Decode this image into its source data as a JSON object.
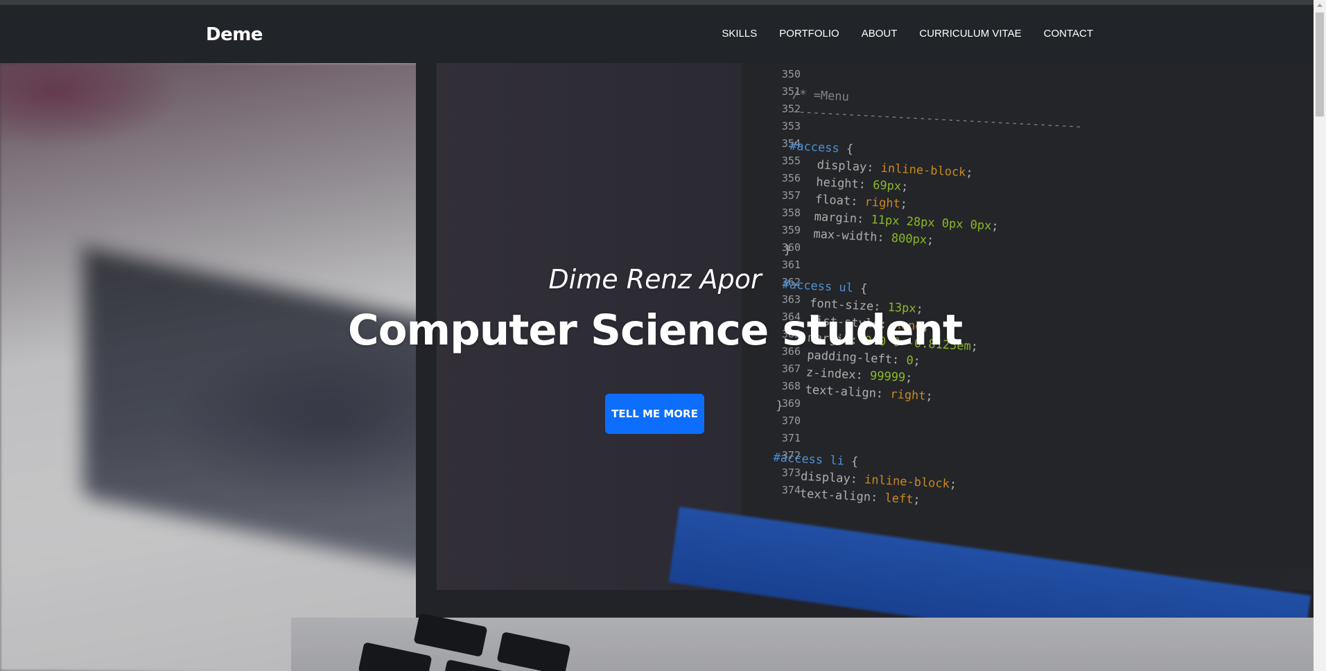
{
  "navbar": {
    "brand": "Deme",
    "links": [
      {
        "label": "SKILLS"
      },
      {
        "label": "PORTFOLIO"
      },
      {
        "label": "ABOUT"
      },
      {
        "label": "CURRICULUM VITAE"
      },
      {
        "label": "CONTACT"
      }
    ]
  },
  "hero": {
    "subtitle": "Dime Renz Apor",
    "title": "Computer Science student",
    "button_label": "TELL ME MORE"
  },
  "background_code": {
    "line_numbers": [
      "350",
      "351",
      "352",
      "353",
      "354",
      "355",
      "356",
      "357",
      "358",
      "359",
      "360",
      "361",
      "362",
      "363",
      "364",
      "365",
      "366",
      "367",
      "368",
      "369",
      "370",
      "371",
      "372",
      "373",
      "374"
    ]
  },
  "colors": {
    "navbar_bg": "#212529",
    "accent": "#0d6efd",
    "text": "#ffffff"
  }
}
